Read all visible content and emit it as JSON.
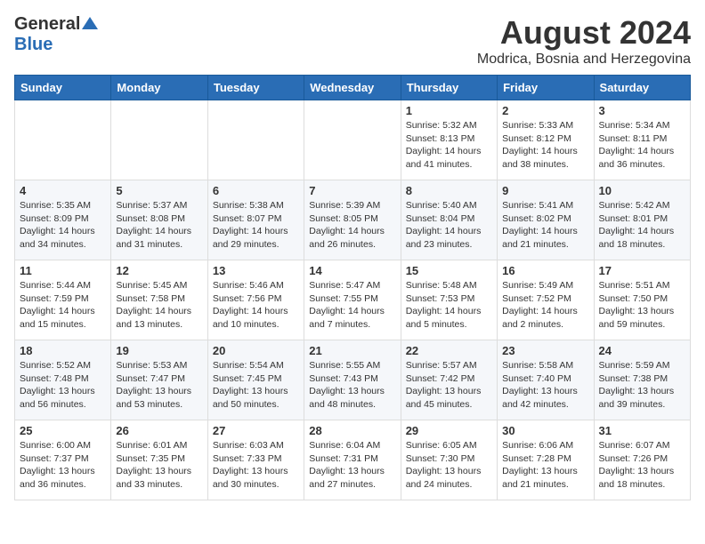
{
  "header": {
    "logo_general": "General",
    "logo_blue": "Blue",
    "month_year": "August 2024",
    "location": "Modrica, Bosnia and Herzegovina"
  },
  "weekdays": [
    "Sunday",
    "Monday",
    "Tuesday",
    "Wednesday",
    "Thursday",
    "Friday",
    "Saturday"
  ],
  "weeks": [
    [
      {
        "day": "",
        "info": ""
      },
      {
        "day": "",
        "info": ""
      },
      {
        "day": "",
        "info": ""
      },
      {
        "day": "",
        "info": ""
      },
      {
        "day": "1",
        "info": "Sunrise: 5:32 AM\nSunset: 8:13 PM\nDaylight: 14 hours\nand 41 minutes."
      },
      {
        "day": "2",
        "info": "Sunrise: 5:33 AM\nSunset: 8:12 PM\nDaylight: 14 hours\nand 38 minutes."
      },
      {
        "day": "3",
        "info": "Sunrise: 5:34 AM\nSunset: 8:11 PM\nDaylight: 14 hours\nand 36 minutes."
      }
    ],
    [
      {
        "day": "4",
        "info": "Sunrise: 5:35 AM\nSunset: 8:09 PM\nDaylight: 14 hours\nand 34 minutes."
      },
      {
        "day": "5",
        "info": "Sunrise: 5:37 AM\nSunset: 8:08 PM\nDaylight: 14 hours\nand 31 minutes."
      },
      {
        "day": "6",
        "info": "Sunrise: 5:38 AM\nSunset: 8:07 PM\nDaylight: 14 hours\nand 29 minutes."
      },
      {
        "day": "7",
        "info": "Sunrise: 5:39 AM\nSunset: 8:05 PM\nDaylight: 14 hours\nand 26 minutes."
      },
      {
        "day": "8",
        "info": "Sunrise: 5:40 AM\nSunset: 8:04 PM\nDaylight: 14 hours\nand 23 minutes."
      },
      {
        "day": "9",
        "info": "Sunrise: 5:41 AM\nSunset: 8:02 PM\nDaylight: 14 hours\nand 21 minutes."
      },
      {
        "day": "10",
        "info": "Sunrise: 5:42 AM\nSunset: 8:01 PM\nDaylight: 14 hours\nand 18 minutes."
      }
    ],
    [
      {
        "day": "11",
        "info": "Sunrise: 5:44 AM\nSunset: 7:59 PM\nDaylight: 14 hours\nand 15 minutes."
      },
      {
        "day": "12",
        "info": "Sunrise: 5:45 AM\nSunset: 7:58 PM\nDaylight: 14 hours\nand 13 minutes."
      },
      {
        "day": "13",
        "info": "Sunrise: 5:46 AM\nSunset: 7:56 PM\nDaylight: 14 hours\nand 10 minutes."
      },
      {
        "day": "14",
        "info": "Sunrise: 5:47 AM\nSunset: 7:55 PM\nDaylight: 14 hours\nand 7 minutes."
      },
      {
        "day": "15",
        "info": "Sunrise: 5:48 AM\nSunset: 7:53 PM\nDaylight: 14 hours\nand 5 minutes."
      },
      {
        "day": "16",
        "info": "Sunrise: 5:49 AM\nSunset: 7:52 PM\nDaylight: 14 hours\nand 2 minutes."
      },
      {
        "day": "17",
        "info": "Sunrise: 5:51 AM\nSunset: 7:50 PM\nDaylight: 13 hours\nand 59 minutes."
      }
    ],
    [
      {
        "day": "18",
        "info": "Sunrise: 5:52 AM\nSunset: 7:48 PM\nDaylight: 13 hours\nand 56 minutes."
      },
      {
        "day": "19",
        "info": "Sunrise: 5:53 AM\nSunset: 7:47 PM\nDaylight: 13 hours\nand 53 minutes."
      },
      {
        "day": "20",
        "info": "Sunrise: 5:54 AM\nSunset: 7:45 PM\nDaylight: 13 hours\nand 50 minutes."
      },
      {
        "day": "21",
        "info": "Sunrise: 5:55 AM\nSunset: 7:43 PM\nDaylight: 13 hours\nand 48 minutes."
      },
      {
        "day": "22",
        "info": "Sunrise: 5:57 AM\nSunset: 7:42 PM\nDaylight: 13 hours\nand 45 minutes."
      },
      {
        "day": "23",
        "info": "Sunrise: 5:58 AM\nSunset: 7:40 PM\nDaylight: 13 hours\nand 42 minutes."
      },
      {
        "day": "24",
        "info": "Sunrise: 5:59 AM\nSunset: 7:38 PM\nDaylight: 13 hours\nand 39 minutes."
      }
    ],
    [
      {
        "day": "25",
        "info": "Sunrise: 6:00 AM\nSunset: 7:37 PM\nDaylight: 13 hours\nand 36 minutes."
      },
      {
        "day": "26",
        "info": "Sunrise: 6:01 AM\nSunset: 7:35 PM\nDaylight: 13 hours\nand 33 minutes."
      },
      {
        "day": "27",
        "info": "Sunrise: 6:03 AM\nSunset: 7:33 PM\nDaylight: 13 hours\nand 30 minutes."
      },
      {
        "day": "28",
        "info": "Sunrise: 6:04 AM\nSunset: 7:31 PM\nDaylight: 13 hours\nand 27 minutes."
      },
      {
        "day": "29",
        "info": "Sunrise: 6:05 AM\nSunset: 7:30 PM\nDaylight: 13 hours\nand 24 minutes."
      },
      {
        "day": "30",
        "info": "Sunrise: 6:06 AM\nSunset: 7:28 PM\nDaylight: 13 hours\nand 21 minutes."
      },
      {
        "day": "31",
        "info": "Sunrise: 6:07 AM\nSunset: 7:26 PM\nDaylight: 13 hours\nand 18 minutes."
      }
    ]
  ]
}
